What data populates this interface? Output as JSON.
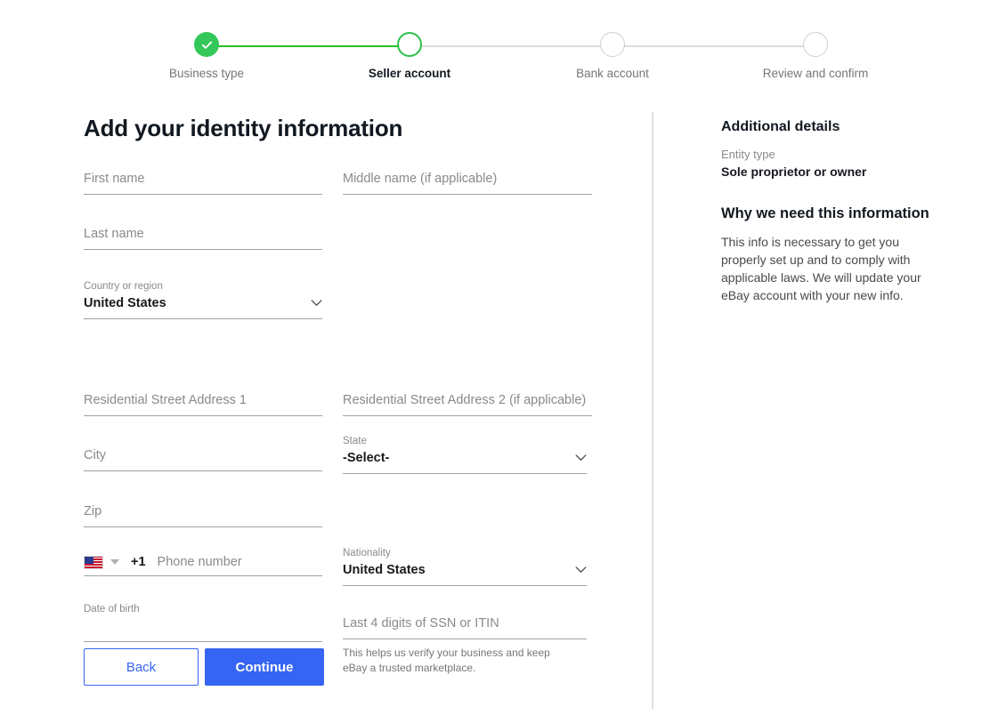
{
  "stepper": {
    "steps": [
      {
        "label": "Business type",
        "state": "complete"
      },
      {
        "label": "Seller account",
        "state": "current"
      },
      {
        "label": "Bank account",
        "state": "upcoming"
      },
      {
        "label": "Review and confirm",
        "state": "upcoming"
      }
    ],
    "colors": {
      "complete": "#34c759",
      "current": "#2ec14b",
      "upcoming": "#cfcfcf",
      "line_done": "#28c029",
      "line_todo": "#dcdcdc"
    }
  },
  "main": {
    "title": "Add your identity information",
    "fields": {
      "first_name": {
        "placeholder": "First name"
      },
      "middle_name": {
        "placeholder": "Middle name (if applicable)"
      },
      "last_name": {
        "placeholder": "Last name"
      },
      "country": {
        "label": "Country or region",
        "value": "United States"
      },
      "address1": {
        "placeholder": "Residential Street Address 1"
      },
      "address2": {
        "placeholder": "Residential Street Address 2 (if applicable)"
      },
      "city": {
        "placeholder": "City"
      },
      "state": {
        "label": "State",
        "value": "-Select-"
      },
      "zip": {
        "placeholder": "Zip"
      },
      "phone": {
        "dial_code": "+1",
        "placeholder": "Phone number",
        "flag": "us-flag-icon"
      },
      "nationality": {
        "label": "Nationality",
        "value": "United States"
      },
      "dob": {
        "label": "Date of birth",
        "value": ""
      },
      "ssn": {
        "placeholder": "Last 4 digits of SSN or ITIN",
        "helper": "This helps us verify your business and keep eBay a trusted marketplace."
      }
    },
    "buttons": {
      "back": "Back",
      "continue": "Continue"
    },
    "accent_blue": "#3665f3"
  },
  "sidebar": {
    "heading": "Additional details",
    "entity_label": "Entity type",
    "entity_value": "Sole proprietor or owner",
    "why_heading": "Why we need this information",
    "why_body": "This info is necessary to get you properly set up and to comply with applicable laws. We will update your eBay account with your new info."
  }
}
